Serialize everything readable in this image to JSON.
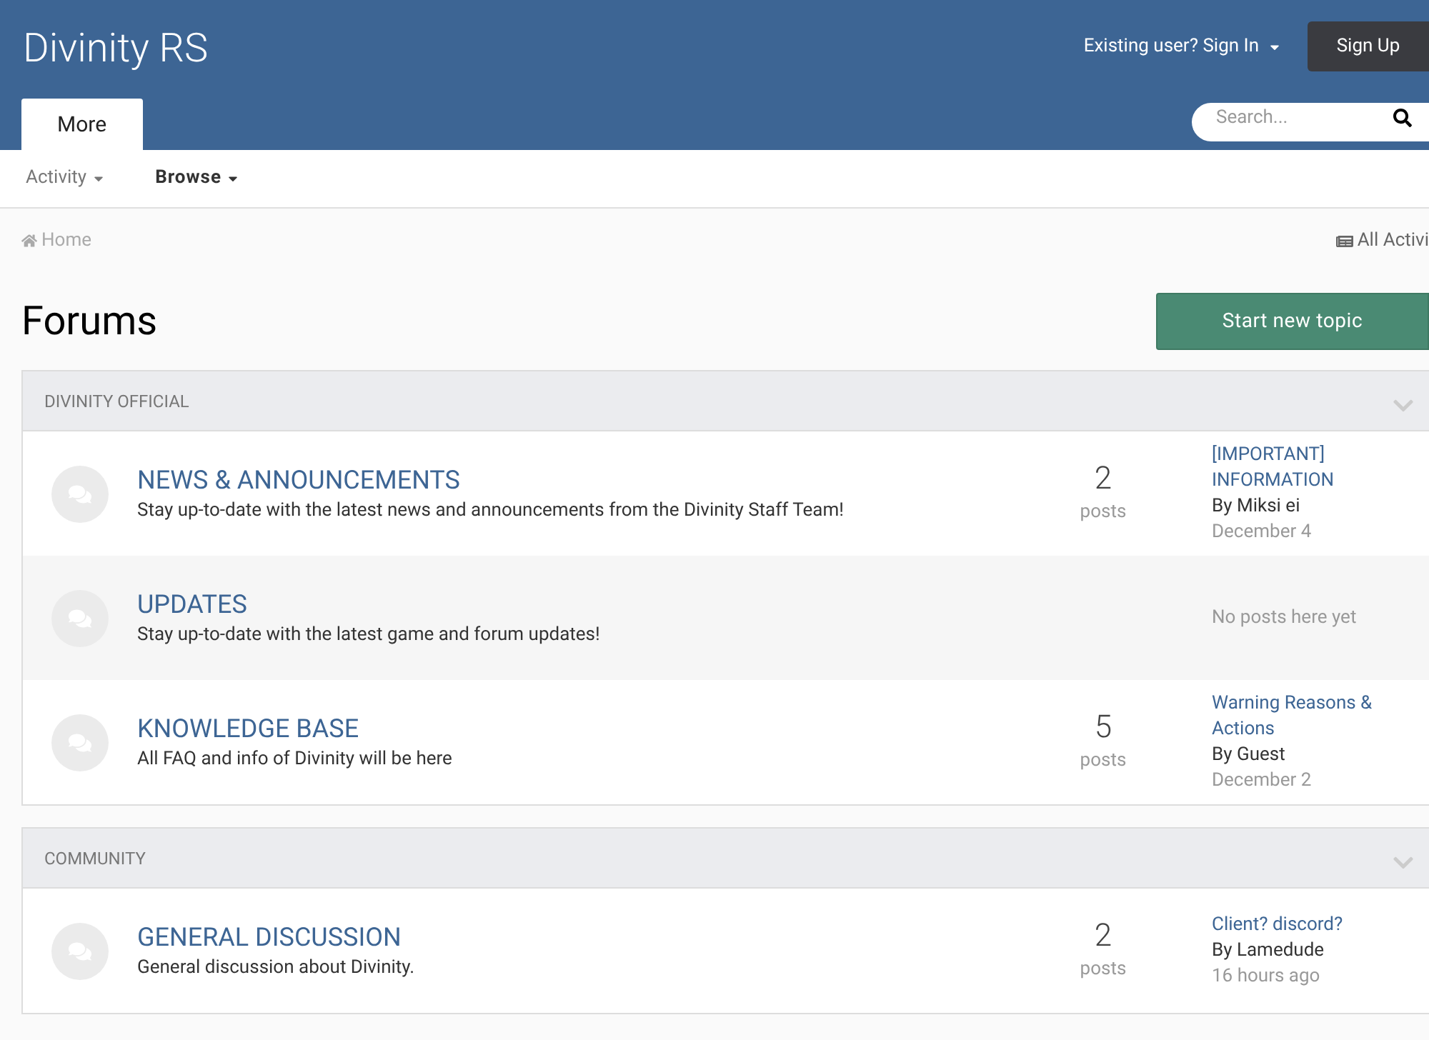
{
  "site_title": "Divinity RS",
  "sign_in": "Existing user? Sign In",
  "sign_up": "Sign Up",
  "header_tabs": [
    {
      "label": "More",
      "selected": true
    }
  ],
  "search": {
    "placeholder": "Search..."
  },
  "subnav": [
    {
      "label": "Activity",
      "selected": false
    },
    {
      "label": "Browse",
      "selected": true
    }
  ],
  "breadcrumb": "Home",
  "all_activity": "All Activi",
  "page_title": "Forums",
  "start_button": "Start new topic",
  "categories": [
    {
      "title": "DIVINITY OFFICIAL",
      "expanded": true,
      "forums": [
        {
          "title": "NEWS & ANNOUNCEMENTS",
          "description": "Stay up-to-date with the latest news and announcements from the Divinity Staff Team!",
          "count": "2",
          "count_label": "posts",
          "last_post": {
            "title": "[IMPORTANT] INFORMATION",
            "author": "By Miksi ei",
            "date": "December 4"
          }
        },
        {
          "title": "UPDATES",
          "description": "Stay up-to-date with the latest game and forum updates!",
          "empty_text": "No posts here yet"
        },
        {
          "title": "KNOWLEDGE BASE",
          "description": "All FAQ and info of Divinity will be here",
          "count": "5",
          "count_label": "posts",
          "last_post": {
            "title": "Warning Reasons & Actions",
            "author": "By Guest",
            "date": "December 2"
          }
        }
      ]
    },
    {
      "title": "COMMUNITY",
      "expanded": true,
      "forums": [
        {
          "title": "GENERAL DISCUSSION",
          "description": "General discussion about Divinity.",
          "count": "2",
          "count_label": "posts",
          "last_post": {
            "title": "Client? discord?",
            "author": "By Lamedude",
            "date": "16 hours ago"
          }
        }
      ]
    }
  ]
}
